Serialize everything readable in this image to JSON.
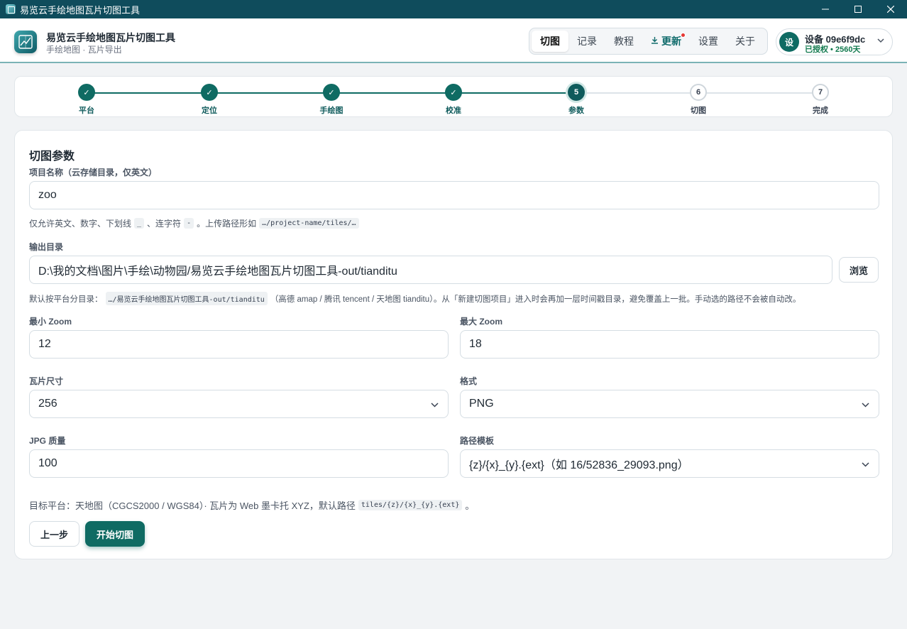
{
  "titlebar": {
    "title": "易览云手绘地图瓦片切图工具"
  },
  "header": {
    "app_title": "易览云手绘地图瓦片切图工具",
    "app_subtitle": "手绘地图 · 瓦片导出"
  },
  "nav": {
    "items": [
      {
        "label": "切图",
        "active": true
      },
      {
        "label": "记录"
      },
      {
        "label": "教程"
      },
      {
        "label": "更新",
        "icon": "download-icon",
        "badge": "red-dot"
      },
      {
        "label": "设置"
      },
      {
        "label": "关于"
      }
    ]
  },
  "device": {
    "avatar": "设",
    "name": "设备 09e6f9dc",
    "status": "已授权 • 2560天"
  },
  "stepper": {
    "current": 5,
    "steps": [
      {
        "num": "1",
        "label": "平台",
        "state": "done"
      },
      {
        "num": "2",
        "label": "定位",
        "state": "done"
      },
      {
        "num": "3",
        "label": "手绘图",
        "state": "done"
      },
      {
        "num": "4",
        "label": "校准",
        "state": "done"
      },
      {
        "num": "5",
        "label": "参数",
        "state": "current"
      },
      {
        "num": "6",
        "label": "切图",
        "state": "todo"
      },
      {
        "num": "7",
        "label": "完成",
        "state": "todo"
      }
    ]
  },
  "form": {
    "title": "切图参数",
    "project": {
      "label": "项目名称（云存储目录，仅英文）",
      "value": "zoo",
      "hint_pre": "仅允许英文、数字、下划线",
      "hint_code1": "_",
      "hint_mid1": "、连字符",
      "hint_code2": "-",
      "hint_mid2": "。上传路径形如",
      "hint_code3": "…/project-name/tiles/…"
    },
    "output": {
      "label": "输出目录",
      "value": "D:\\我的文档\\图片\\手绘\\动物园/易览云手绘地图瓦片切图工具-out/tianditu",
      "browse": "浏览",
      "hint_pre": "默认按平台分目录：",
      "hint_code": "…/易览云手绘地图瓦片切图工具-out/tianditu",
      "hint_post": "（高德 amap / 腾讯 tencent / 天地图 tianditu）。从「新建切图项目」进入时会再加一层时间戳目录，避免覆盖上一批。手动选的路径不会被自动改。"
    },
    "min_zoom": {
      "label": "最小 Zoom",
      "value": "12"
    },
    "max_zoom": {
      "label": "最大 Zoom",
      "value": "18"
    },
    "tile_size": {
      "label": "瓦片尺寸",
      "value": "256"
    },
    "format": {
      "label": "格式",
      "value": "PNG"
    },
    "jpg_quality": {
      "label": "JPG 质量",
      "value": "100"
    },
    "path_template": {
      "label": "路径模板",
      "value": "{z}/{x}_{y}.{ext}（如 16/52836_29093.png）"
    },
    "platform_note_pre": "目标平台：天地图（CGCS2000 / WGS84）· 瓦片为 Web 墨卡托 XYZ，默认路径",
    "platform_note_code": "tiles/{z}/{x}_{y}.{ext}",
    "platform_note_post": "。",
    "prev_button": "上一步",
    "start_button": "开始切图"
  },
  "colors": {
    "accent": "#0f6b63",
    "titlebar": "#0f4c5c",
    "update_dot": "#e53935"
  }
}
